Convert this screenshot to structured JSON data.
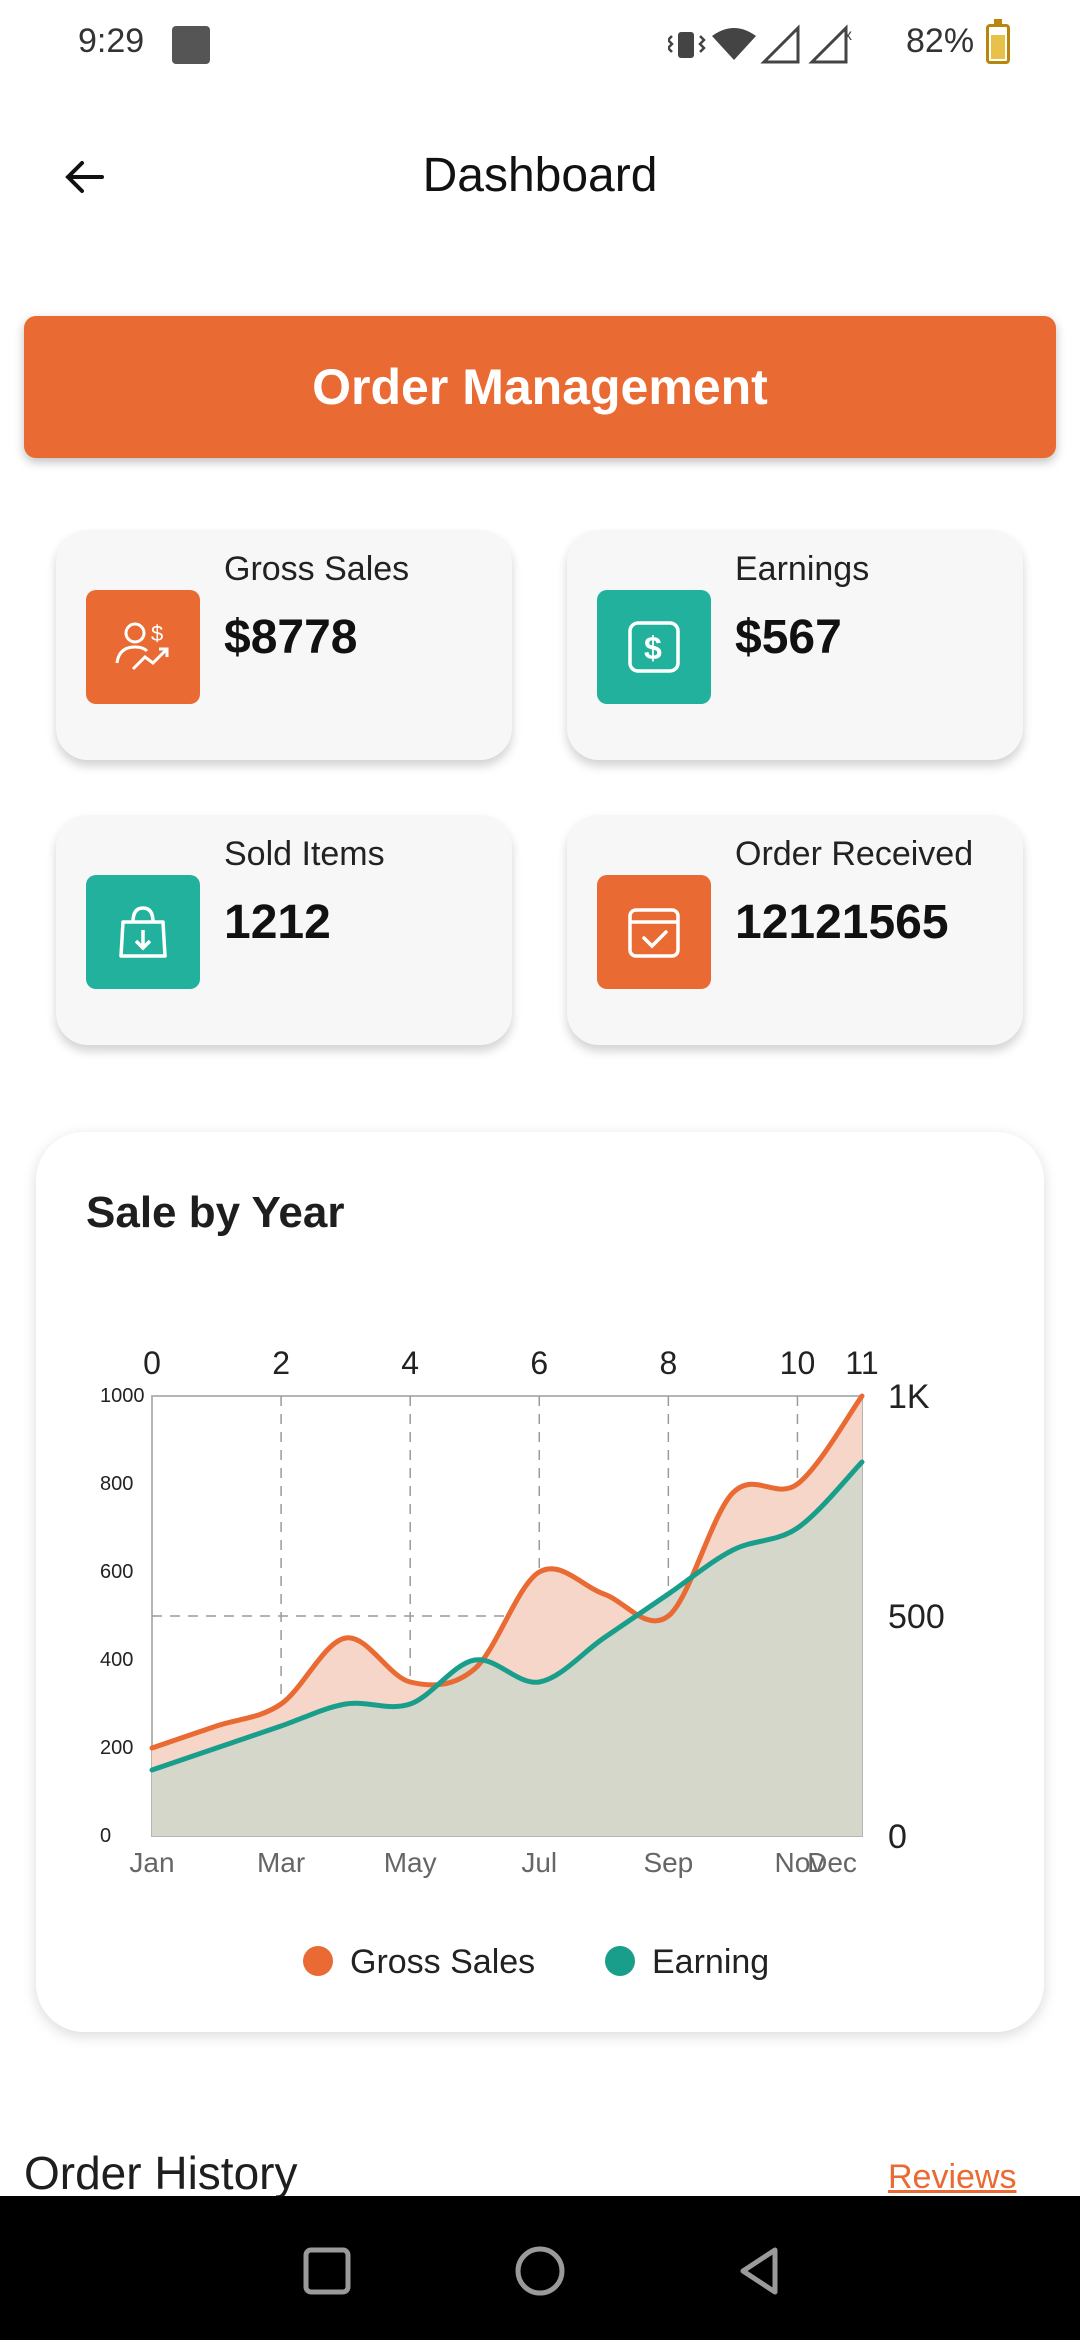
{
  "status": {
    "time": "9:29",
    "battery": "82%"
  },
  "header": {
    "title": "Dashboard"
  },
  "order_management": {
    "label": "Order Management"
  },
  "stats": [
    {
      "label": "Gross Sales",
      "value": "$8778",
      "icon": "user-dollar-icon",
      "color": "#e96a32"
    },
    {
      "label": "Earnings",
      "value": "$567",
      "icon": "dollar-icon",
      "color": "#21b19d"
    },
    {
      "label": "Sold Items",
      "value": "1212",
      "icon": "shopping-bag-icon",
      "color": "#21b19d"
    },
    {
      "label": "Order Received",
      "value": "12121565",
      "icon": "calendar-check-icon",
      "color": "#e96a32"
    }
  ],
  "order_history": {
    "title": "Order History",
    "reviews": "Reviews"
  },
  "chart_data": {
    "type": "area",
    "title": "Sale by Year",
    "categories": [
      "Jan",
      "Mar",
      "May",
      "Jul",
      "Sep",
      "Nov",
      "Dec"
    ],
    "x": [
      0,
      1,
      2,
      3,
      4,
      5,
      6,
      7,
      8,
      9,
      10,
      11
    ],
    "x_top_ticks": [
      "0",
      "2",
      "4",
      "6",
      "8",
      "10",
      "11"
    ],
    "y_left_ticks": [
      "0",
      "200",
      "400",
      "600",
      "800",
      "1000"
    ],
    "y_right_ticks": [
      "0",
      "500",
      "1K"
    ],
    "ylim": [
      0,
      1000
    ],
    "grid": true,
    "legend": "bottom",
    "series": [
      {
        "name": "Gross Sales",
        "color": "#e96a32",
        "values": [
          200,
          250,
          300,
          450,
          350,
          380,
          600,
          550,
          500,
          780,
          800,
          1000
        ]
      },
      {
        "name": "Earning",
        "color": "#1a9e8c",
        "values": [
          150,
          200,
          250,
          300,
          300,
          400,
          350,
          450,
          550,
          650,
          700,
          850
        ]
      }
    ]
  }
}
